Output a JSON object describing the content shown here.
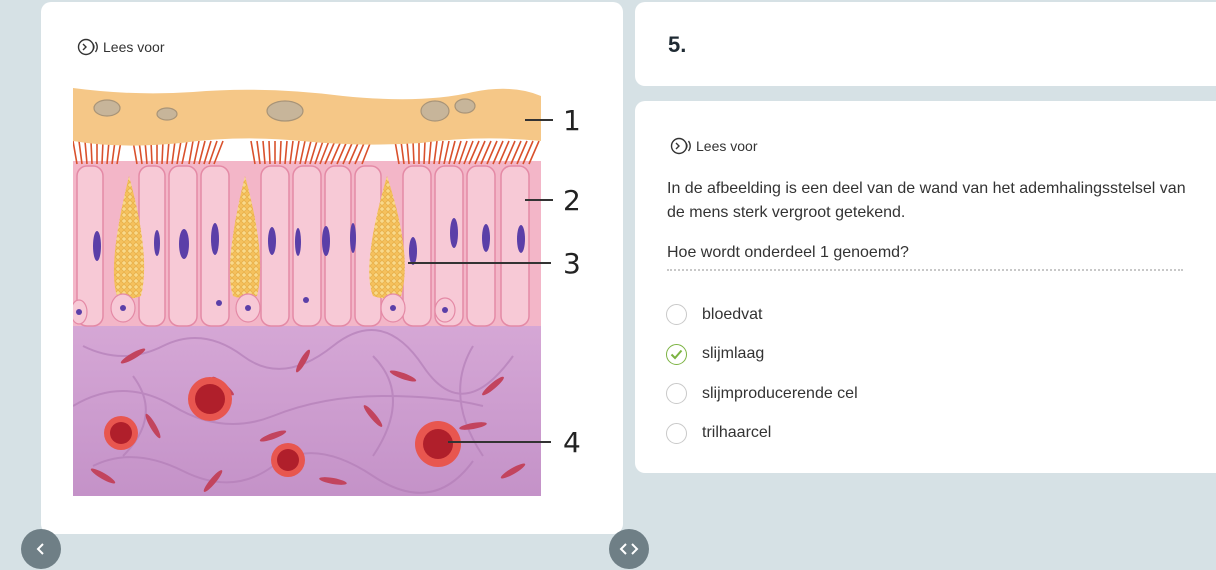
{
  "lees_voor_label": "Lees voor",
  "question": {
    "number": "5.",
    "text": "In de afbeelding is een deel van de wand van het ademhalingsstelsel van de mens sterk vergroot getekend.",
    "prompt": "Hoe wordt onderdeel 1 genoemd?",
    "options": [
      {
        "label": "bloedvat",
        "selected": false
      },
      {
        "label": "slijmlaag",
        "selected": true
      },
      {
        "label": "slijmproducerende cel",
        "selected": false
      },
      {
        "label": "trilhaarcel",
        "selected": false
      }
    ]
  },
  "illustration": {
    "labels": [
      "1",
      "2",
      "3",
      "4"
    ]
  },
  "nav": {
    "prev_icon": "chevron-left-icon",
    "expand_icon": "code-chevrons-icon"
  },
  "colors": {
    "accent_green": "#7cb342",
    "background": "#d6e1e5",
    "nav_button": "#6f7f86"
  }
}
